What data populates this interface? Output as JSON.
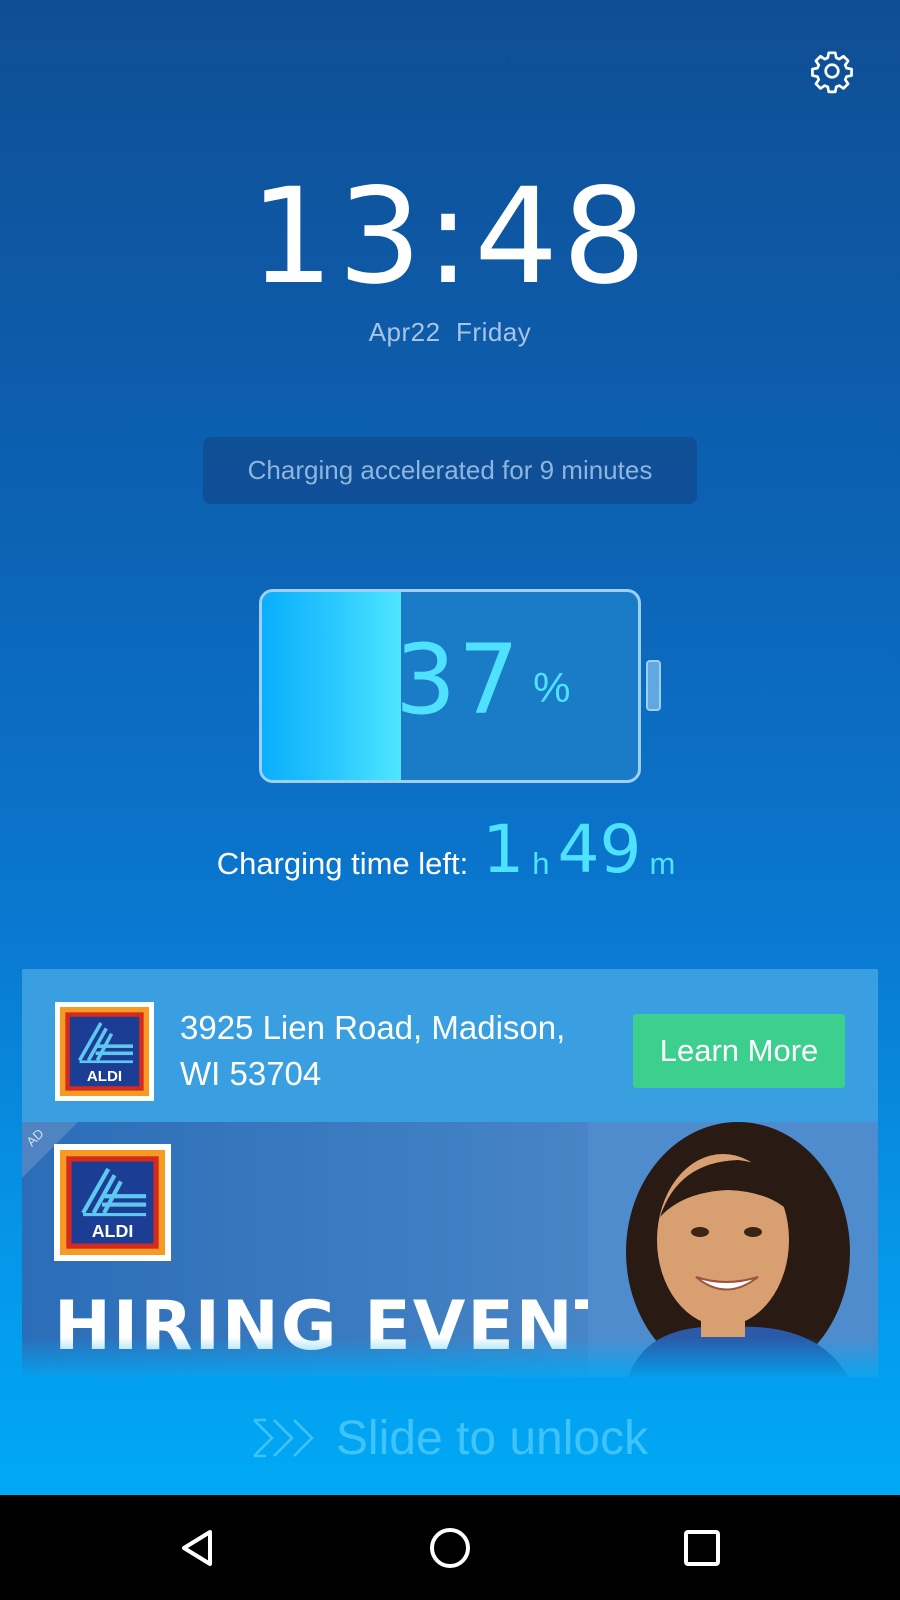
{
  "clock": {
    "time": "13:48",
    "date": "Apr22  Friday"
  },
  "status": {
    "accelerated_text": "Charging accelerated for 9 minutes"
  },
  "battery": {
    "percent_value": "37",
    "percent_sign": "%",
    "fill_fraction": 0.37
  },
  "charging_time": {
    "label": "Charging time left:",
    "hours": "1",
    "hours_unit": "h",
    "minutes": "49",
    "minutes_unit": "m"
  },
  "ad": {
    "logo_text": "ALDI",
    "address": "3925 Lien Road, Madison, WI 53704",
    "cta_label": "Learn More",
    "corner_label": "AD",
    "banner_logo_text": "ALDI",
    "banner_headline": "HIRING EVENT"
  },
  "unlock": {
    "label": "Slide to unlock"
  },
  "icons": {
    "settings": "gear-icon",
    "unlock_arrows": "chevrons-right-icon",
    "nav_back": "back-triangle-icon",
    "nav_home": "home-circle-icon",
    "nav_recents": "recents-square-icon"
  },
  "colors": {
    "accent": "#4ee2ff",
    "cta": "#3ccf8e",
    "aldi_blue": "#1b3d94",
    "aldi_orange": "#f59a23"
  }
}
